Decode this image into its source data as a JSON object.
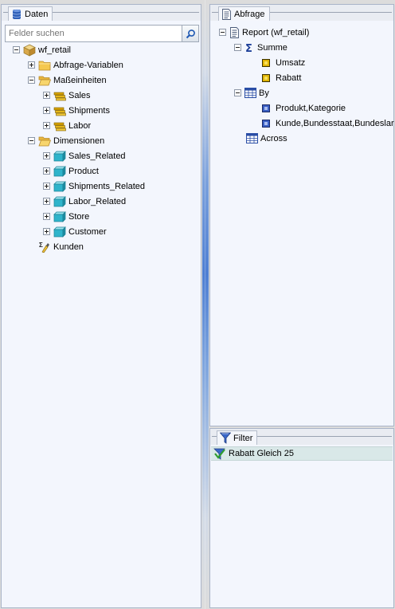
{
  "data_panel": {
    "title": "Daten",
    "title_icon": "database-icon",
    "search": {
      "placeholder": "Felder suchen",
      "value": ""
    },
    "search_icon": "magnifier-icon",
    "tree": {
      "root": "wf_retail",
      "abfrage_variablen": "Abfrage-Variablen",
      "masseinheiten": "Maßeinheiten",
      "sales": "Sales",
      "shipments": "Shipments",
      "labor": "Labor",
      "dimensionen": "Dimensionen",
      "sales_related": "Sales_Related",
      "product": "Product",
      "shipments_related": "Shipments_Related",
      "labor_related": "Labor_Related",
      "store": "Store",
      "customer": "Customer",
      "kunden": "Kunden"
    }
  },
  "query_panel": {
    "title": "Abfrage",
    "title_icon": "report-page-icon",
    "tree": {
      "report": "Report (wf_retail)",
      "summe": "Summe",
      "umsatz": "Umsatz",
      "rabatt": "Rabatt",
      "by": "By",
      "produkt_kategorie": "Produkt,Kategorie",
      "kunde": "Kunde,Bundesstaat,Bundeslar",
      "across": "Across"
    }
  },
  "filter_panel": {
    "title": "Filter",
    "title_icon": "funnel-icon",
    "items": [
      "Rabatt Gleich 25"
    ]
  }
}
